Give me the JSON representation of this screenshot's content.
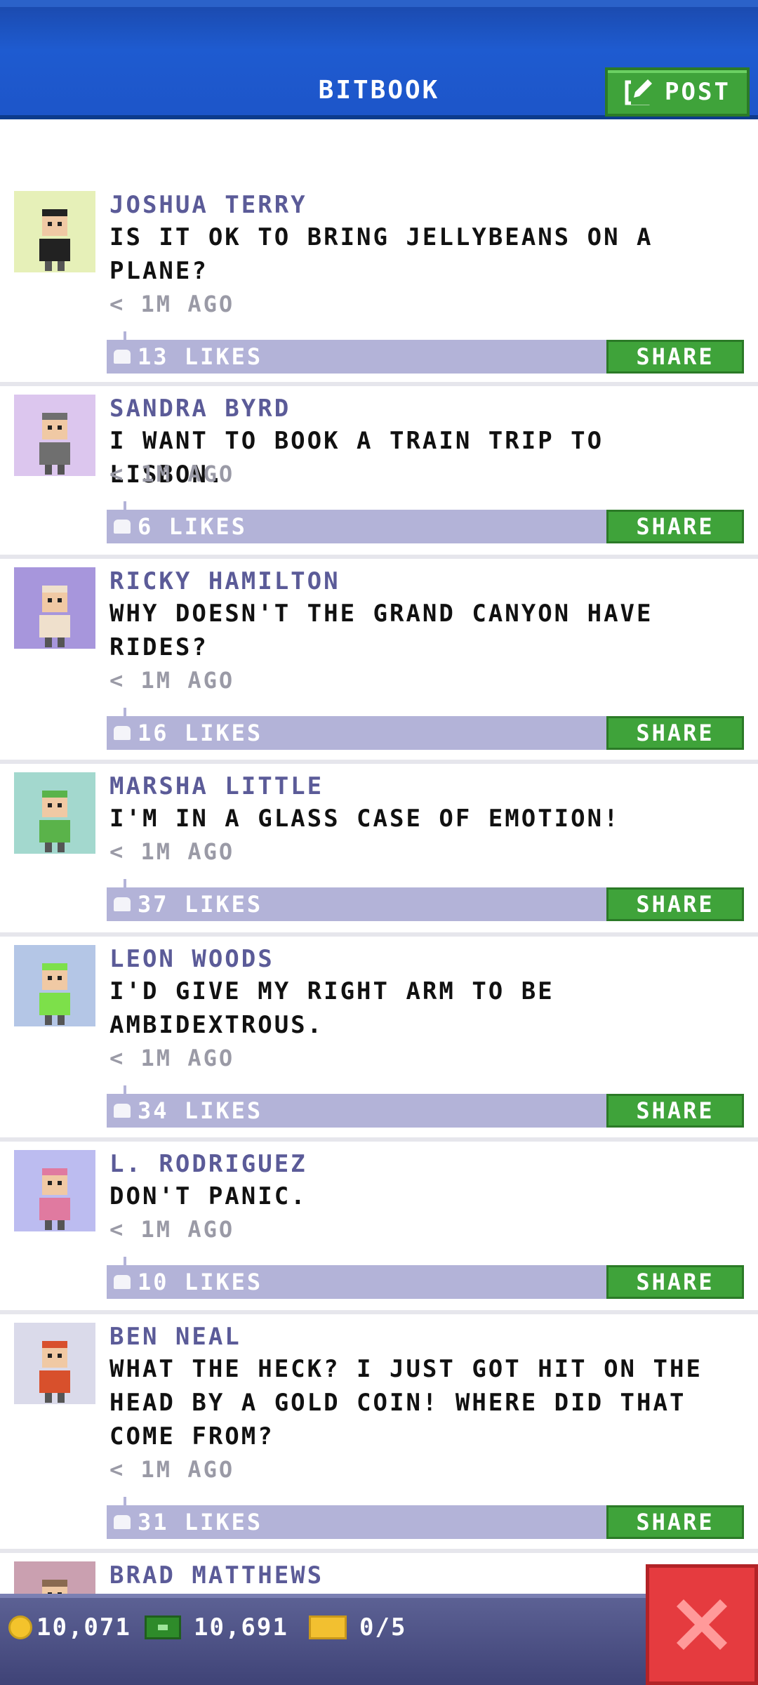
{
  "header": {
    "title": "BITBOOK",
    "post_label": "POST"
  },
  "posts": [
    {
      "author": "JOSHUA TERRY",
      "message": "IS IT OK TO BRING JELLYBEANS ON A PLANE?",
      "time": "< 1M AGO",
      "likes": "13 LIKES",
      "share": "SHARE",
      "avatar_bg": "#e6f0b8",
      "avatar_color": "#222222"
    },
    {
      "author": "SANDRA BYRD",
      "message": "I WANT TO BOOK A TRAIN TRIP TO LISBON.",
      "time": "< 1M AGO",
      "likes": "6 LIKES",
      "share": "SHARE",
      "avatar_bg": "#dcc6ee",
      "avatar_color": "#6f6f6f"
    },
    {
      "author": "RICKY HAMILTON",
      "message": "WHY DOESN'T THE GRAND CANYON HAVE RIDES?",
      "time": "< 1M AGO",
      "likes": "16 LIKES",
      "share": "SHARE",
      "avatar_bg": "#a796dc",
      "avatar_color": "#efe0cc"
    },
    {
      "author": "MARSHA LITTLE",
      "message": "I'M IN A GLASS CASE OF EMOTION!",
      "time": "< 1M AGO",
      "likes": "37 LIKES",
      "share": "SHARE",
      "avatar_bg": "#a3d8ce",
      "avatar_color": "#5ab34a"
    },
    {
      "author": "LEON WOODS",
      "message": "I'D GIVE MY RIGHT ARM TO BE AMBIDEXTROUS.",
      "time": "< 1M AGO",
      "likes": "34 LIKES",
      "share": "SHARE",
      "avatar_bg": "#b4c6e6",
      "avatar_color": "#7de04a"
    },
    {
      "author": "L. RODRIGUEZ",
      "message": "DON'T PANIC.",
      "time": "< 1M AGO",
      "likes": "10 LIKES",
      "share": "SHARE",
      "avatar_bg": "#bcbcf0",
      "avatar_color": "#e07aa0"
    },
    {
      "author": "BEN NEAL",
      "message": "WHAT THE HECK? I JUST GOT HIT ON THE HEAD BY A GOLD COIN! WHERE DID THAT COME FROM?",
      "time": "< 1M AGO",
      "likes": "31 LIKES",
      "share": "SHARE",
      "avatar_bg": "#dadaea",
      "avatar_color": "#d8502c"
    },
    {
      "author": "BRAD MATTHEWS",
      "message": "",
      "time": "",
      "likes": "",
      "share": "",
      "avatar_bg": "#caa0b0",
      "avatar_color": "#8a6a50"
    }
  ],
  "bottom_bar": {
    "coins": "10,071",
    "bux": "10,691",
    "tickets": "0/5"
  },
  "icons": {
    "post": "edit-icon",
    "like": "thumbs-up-icon",
    "coin": "coin-icon",
    "bux": "cash-icon",
    "ticket": "ticket-icon",
    "close": "close-icon"
  },
  "colors": {
    "header_blue": "#1e5bd0",
    "accent_green": "#3fa33a",
    "likes_bar": "#b3b3d8",
    "author_purple": "#5b5b98",
    "close_red": "#e53b3f"
  }
}
